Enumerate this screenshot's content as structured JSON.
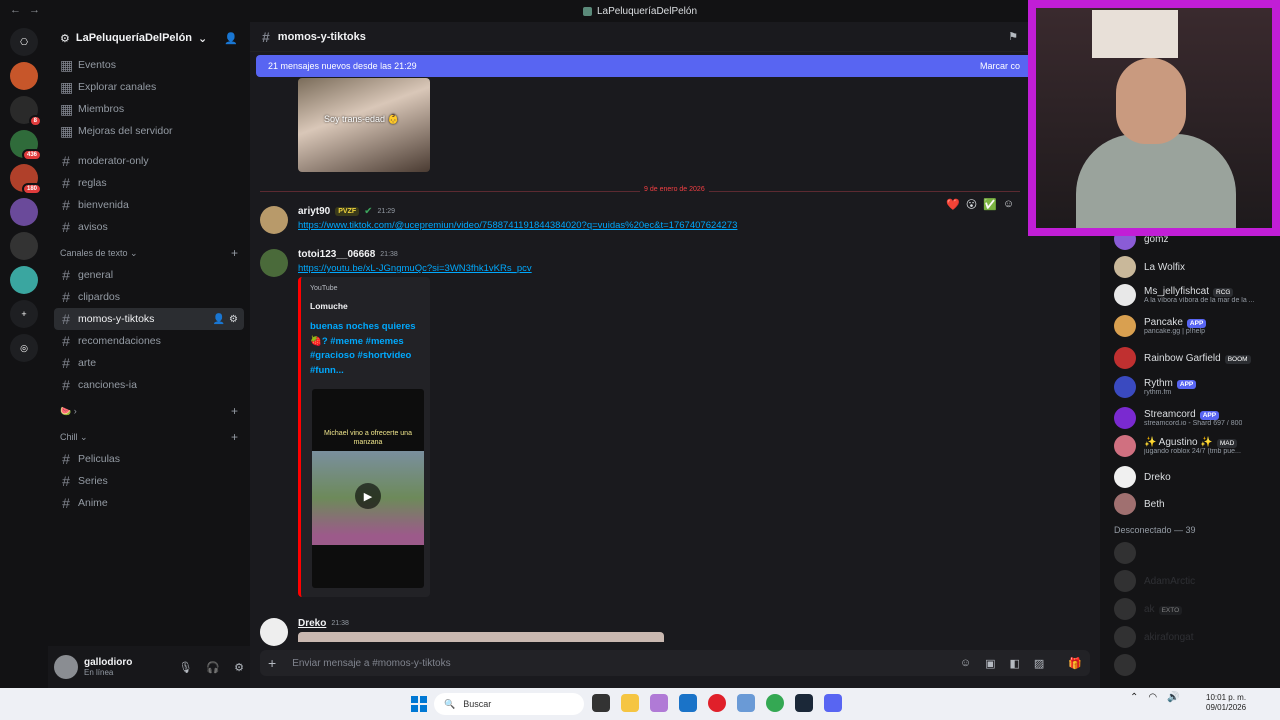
{
  "window": {
    "title": "LaPeluqueríaDelPelón"
  },
  "guilds": [
    {
      "name": "discord-home",
      "color": "#1e1f22",
      "glyph": "⎔"
    },
    {
      "name": "server-1",
      "color": "#c7562a"
    },
    {
      "name": "server-2",
      "color": "#2a2a2a",
      "badge": "8"
    },
    {
      "name": "server-3",
      "color": "#2f6b3a",
      "badge": "436"
    },
    {
      "name": "server-4",
      "color": "#b0402a",
      "badge": "180"
    },
    {
      "name": "server-5",
      "color": "#6a4a9a"
    },
    {
      "name": "server-6",
      "color": "#333"
    },
    {
      "name": "server-7",
      "color": "#3aa6a0"
    }
  ],
  "sidebar": {
    "server_name": "LaPeluqueríaDelPelón",
    "top_items": [
      "Eventos",
      "Explorar canales",
      "Miembros",
      "Mejoras del servidor"
    ],
    "channels_a": [
      "moderator-only",
      "reglas",
      "bienvenida",
      "avisos"
    ],
    "category_text": "Canales de texto",
    "channels_b": [
      "general",
      "clipardos",
      "momos-y-tiktoks",
      "recomendaciones",
      "arte",
      "canciones-ia"
    ],
    "category_chill": "Chill",
    "channels_c": [
      "Peliculas",
      "Series",
      "Anime"
    ]
  },
  "user": {
    "name": "gallodioro",
    "status": "En línea"
  },
  "chat": {
    "channel": "momos-y-tiktoks",
    "banner_text": "21 mensajes nuevos desde las 21:29",
    "banner_action": "Marcar co",
    "thumb_caption": "Soy trans-edad 👶",
    "divider_date": "9 de enero de 2026",
    "msg1": {
      "author": "ariyt90",
      "tag": "PVZF",
      "time": "21:29",
      "link": "https://www.tiktok.com/@ucepremiun/video/7588741191844384020?q=vuidas%20ec&t=1767407624273"
    },
    "msg2": {
      "author": "totoi123__06668",
      "time": "21:38",
      "link": "https://youtu.be/xL-JGngmuQc?si=3WN3fhk1vKRs_pcv",
      "embed_provider": "YouTube",
      "embed_author": "Lomuche",
      "embed_title": "buenas noches quieres 🍓? #meme #memes #gracioso #shortvideo #funn...",
      "video_caption": "Michael vino a ofrecerte una manzana"
    },
    "msg3": {
      "author": "Dreko",
      "time": "21:38"
    },
    "composer_placeholder": "Enviar mensaje a #momos-y-tiktoks"
  },
  "members": {
    "online": [
      {
        "name": "gomz",
        "color": "#8a5cd6"
      },
      {
        "name": "La Wolfix",
        "color": "#c9b89a"
      },
      {
        "name": "Ms_jellyfishcat",
        "tag": "RCG",
        "sub": "A la víbora víbora de la mar de la ...",
        "color": "#e8e8e8"
      },
      {
        "name": "Pancake",
        "app": "APP",
        "sub": "pancake.gg | p!help",
        "color": "#d9a050"
      },
      {
        "name": "Rainbow Garfield",
        "tag": "BOOM",
        "color": "#c03030"
      },
      {
        "name": "Rythm",
        "app": "APP",
        "sub": "rythm.fm",
        "color": "#3a4ac0"
      },
      {
        "name": "Streamcord",
        "app": "APP",
        "sub": "streamcord.io - Shard 697 / 800",
        "color": "#7a2ad0"
      },
      {
        "name": "✨ Agustino ✨",
        "tag": "MAD",
        "sub": "jugando roblox 24/7 (tmb pue...",
        "color": "#d07080"
      },
      {
        "name": "Dreko",
        "color": "#f0f0f0"
      },
      {
        "name": "Beth",
        "color": "#a07070"
      }
    ],
    "offline_label": "Desconectado — 39",
    "offline": [
      {
        "name": "",
        "color": "#555"
      },
      {
        "name": "AdamArctic",
        "color": "#555"
      },
      {
        "name": "ak",
        "tag": "EXTO",
        "color": "#555"
      },
      {
        "name": "akirafongat",
        "color": "#555"
      },
      {
        "name": "",
        "color": "#555"
      }
    ]
  },
  "taskbar": {
    "search": "Buscar",
    "time": "10:01 p. m.",
    "date": "09/01/2026"
  }
}
